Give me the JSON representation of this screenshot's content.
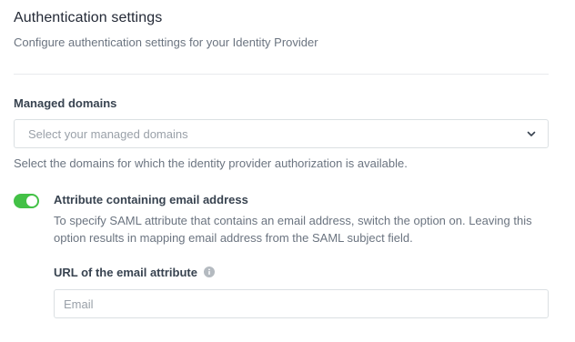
{
  "header": {
    "title": "Authentication settings",
    "subtitle": "Configure authentication settings for your Identity Provider"
  },
  "managed_domains": {
    "label": "Managed domains",
    "placeholder": "Select your managed domains",
    "helper": "Select the domains for which the identity provider authorization is available."
  },
  "email_attribute_toggle": {
    "enabled": true,
    "label": "Attribute containing email address",
    "description": "To specify SAML attribute that contains an email address, switch the option on. Leaving this option results in mapping email address from the SAML subject field."
  },
  "email_attribute_url": {
    "label": "URL of the email attribute",
    "placeholder": "Email",
    "info_icon": "info-icon"
  },
  "colors": {
    "toggle_on": "#43c146",
    "text": "#384350",
    "muted": "#6b7480",
    "border": "#dbe0e3"
  }
}
